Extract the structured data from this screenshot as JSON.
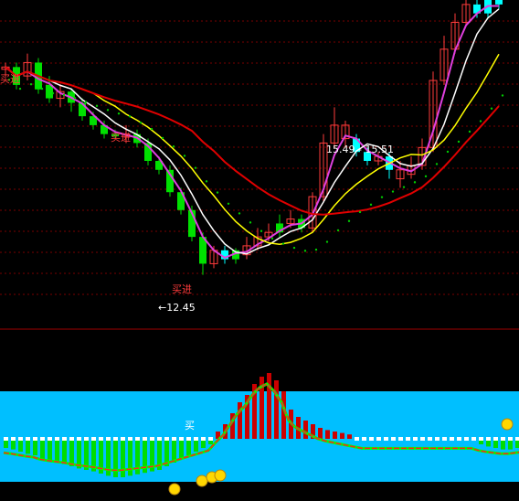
{
  "colors": {
    "background": "#000000",
    "up": "#ff3b3b",
    "down": "#00e000",
    "doji": "#00ffff",
    "ma_white": "#ffffff",
    "ma_yellow": "#ffff00",
    "ma_magenta": "#e040e0",
    "ma_red": "#e00000",
    "dots_green": "#00cc00",
    "panel_bg": "#00bfff",
    "hist_red": "#cc0000"
  },
  "annotations": {
    "buy_label": "买进",
    "low_label": "←12.45",
    "range_label": "15.49 - 15.51",
    "top_left_buy": "买进",
    "lower_buy": "买"
  },
  "chart_data": [
    {
      "type": "candlestick",
      "title": "",
      "grid": true,
      "ylim": [
        11.4,
        18.6
      ],
      "low_marker": 12.45,
      "range_marker": [
        15.49,
        15.51
      ],
      "candles": [
        {
          "o": 17.05,
          "c": 17.1,
          "h": 17.2,
          "l": 16.9,
          "dir": "up"
        },
        {
          "o": 17.1,
          "c": 16.7,
          "h": 17.2,
          "l": 16.6,
          "dir": "down"
        },
        {
          "o": 16.9,
          "c": 17.2,
          "h": 17.4,
          "l": 16.8,
          "dir": "up"
        },
        {
          "o": 17.2,
          "c": 16.6,
          "h": 17.3,
          "l": 16.5,
          "dir": "down"
        },
        {
          "o": 16.7,
          "c": 16.4,
          "h": 16.9,
          "l": 16.3,
          "dir": "down"
        },
        {
          "o": 16.4,
          "c": 16.55,
          "h": 16.7,
          "l": 16.2,
          "dir": "up"
        },
        {
          "o": 16.55,
          "c": 16.3,
          "h": 16.6,
          "l": 16.1,
          "dir": "down"
        },
        {
          "o": 16.3,
          "c": 16.0,
          "h": 16.4,
          "l": 15.9,
          "dir": "down"
        },
        {
          "o": 16.0,
          "c": 15.8,
          "h": 16.1,
          "l": 15.7,
          "dir": "down"
        },
        {
          "o": 15.8,
          "c": 15.6,
          "h": 15.9,
          "l": 15.5,
          "dir": "down"
        },
        {
          "o": 15.6,
          "c": 15.55,
          "h": 15.7,
          "l": 15.5,
          "dir": "down"
        },
        {
          "o": 15.55,
          "c": 15.6,
          "h": 15.8,
          "l": 15.4,
          "dir": "up"
        },
        {
          "o": 15.6,
          "c": 15.4,
          "h": 15.7,
          "l": 15.3,
          "dir": "down"
        },
        {
          "o": 15.4,
          "c": 15.0,
          "h": 15.5,
          "l": 14.9,
          "dir": "down"
        },
        {
          "o": 15.0,
          "c": 14.8,
          "h": 15.1,
          "l": 14.7,
          "dir": "down"
        },
        {
          "o": 14.8,
          "c": 14.3,
          "h": 14.9,
          "l": 14.2,
          "dir": "down"
        },
        {
          "o": 14.3,
          "c": 13.9,
          "h": 14.4,
          "l": 13.8,
          "dir": "down"
        },
        {
          "o": 13.9,
          "c": 13.3,
          "h": 14.0,
          "l": 13.2,
          "dir": "down"
        },
        {
          "o": 13.3,
          "c": 12.7,
          "h": 13.4,
          "l": 12.45,
          "dir": "down"
        },
        {
          "o": 12.7,
          "c": 13.0,
          "h": 13.1,
          "l": 12.6,
          "dir": "up"
        },
        {
          "o": 13.0,
          "c": 12.8,
          "h": 13.1,
          "l": 12.7,
          "dir": "doji"
        },
        {
          "o": 12.8,
          "c": 13.0,
          "h": 13.05,
          "l": 12.7,
          "dir": "down"
        },
        {
          "o": 12.9,
          "c": 13.1,
          "h": 13.3,
          "l": 12.8,
          "dir": "up"
        },
        {
          "o": 13.1,
          "c": 13.3,
          "h": 13.5,
          "l": 13.0,
          "dir": "up"
        },
        {
          "o": 13.3,
          "c": 13.4,
          "h": 13.6,
          "l": 13.2,
          "dir": "up"
        },
        {
          "o": 13.4,
          "c": 13.6,
          "h": 13.8,
          "l": 13.3,
          "dir": "down"
        },
        {
          "o": 13.6,
          "c": 13.7,
          "h": 13.9,
          "l": 13.5,
          "dir": "up"
        },
        {
          "o": 13.7,
          "c": 13.5,
          "h": 13.8,
          "l": 13.4,
          "dir": "down"
        },
        {
          "o": 13.5,
          "c": 14.2,
          "h": 14.3,
          "l": 13.4,
          "dir": "up"
        },
        {
          "o": 14.2,
          "c": 15.4,
          "h": 15.6,
          "l": 14.1,
          "dir": "up"
        },
        {
          "o": 15.4,
          "c": 15.8,
          "h": 16.2,
          "l": 15.3,
          "dir": "up"
        },
        {
          "o": 15.8,
          "c": 15.5,
          "h": 15.9,
          "l": 15.3,
          "dir": "up"
        },
        {
          "o": 15.5,
          "c": 15.2,
          "h": 15.6,
          "l": 15.1,
          "dir": "doji"
        },
        {
          "o": 15.2,
          "c": 15.0,
          "h": 15.3,
          "l": 14.9,
          "dir": "doji"
        },
        {
          "o": 15.0,
          "c": 15.1,
          "h": 15.2,
          "l": 14.9,
          "dir": "up"
        },
        {
          "o": 15.1,
          "c": 14.8,
          "h": 15.2,
          "l": 14.6,
          "dir": "doji"
        },
        {
          "o": 14.8,
          "c": 14.6,
          "h": 15.0,
          "l": 14.4,
          "dir": "up"
        },
        {
          "o": 14.7,
          "c": 14.9,
          "h": 15.1,
          "l": 14.6,
          "dir": "up"
        },
        {
          "o": 14.9,
          "c": 15.3,
          "h": 15.5,
          "l": 14.8,
          "dir": "up"
        },
        {
          "o": 15.3,
          "c": 16.8,
          "h": 17.0,
          "l": 15.2,
          "dir": "up"
        },
        {
          "o": 16.8,
          "c": 17.5,
          "h": 17.8,
          "l": 16.7,
          "dir": "up"
        },
        {
          "o": 17.5,
          "c": 18.1,
          "h": 18.3,
          "l": 17.4,
          "dir": "up"
        },
        {
          "o": 18.1,
          "c": 18.5,
          "h": 18.7,
          "l": 18.0,
          "dir": "up"
        },
        {
          "o": 18.5,
          "c": 18.3,
          "h": 18.8,
          "l": 18.2,
          "dir": "doji"
        },
        {
          "o": 18.3,
          "c": 18.6,
          "h": 18.9,
          "l": 18.2,
          "dir": "doji"
        },
        {
          "o": 18.6,
          "c": 18.5,
          "h": 18.9,
          "l": 18.4,
          "dir": "doji"
        }
      ]
    },
    {
      "type": "bar",
      "title": "",
      "grid": false,
      "ylim": [
        -6,
        10
      ],
      "series": [
        {
          "values": [
            0.2,
            0.2,
            0.2,
            0.2,
            0.2,
            0.2,
            0.2,
            0.2,
            0.2,
            0.2,
            0.2,
            0.2,
            0.2,
            0.2,
            0.2,
            0.2,
            0.2,
            0.2,
            0.2,
            0.2,
            0.2,
            0.2,
            0.2,
            0.2,
            0.2,
            0.2,
            0.2,
            0.2,
            0.2,
            1.0,
            2.0,
            3.5,
            5.0,
            6.0,
            7.5,
            8.5,
            9.0,
            8.0,
            6.5,
            4.0,
            3.0,
            2.5,
            2.0,
            1.5,
            1.2,
            1.0,
            0.8,
            0.6,
            0.4,
            0.2,
            0.2,
            0.2,
            0.2,
            0.2,
            0.2,
            0.2,
            0.2,
            0.2,
            0.2,
            0.2,
            0.2,
            0.2,
            0.2,
            0.2,
            0.2,
            0.2,
            0.2,
            0.2,
            0.2,
            0.2,
            0.2,
            0.2
          ]
        },
        {
          "values": [
            -1.0,
            -1.2,
            -1.5,
            -1.8,
            -2.0,
            -2.5,
            -2.8,
            -3.0,
            -3.2,
            -3.5,
            -3.8,
            -4.0,
            -4.2,
            -4.5,
            -4.8,
            -5.0,
            -5.0,
            -4.8,
            -4.6,
            -4.4,
            -4.2,
            -4.0,
            -3.5,
            -3.0,
            -2.5,
            -2.0,
            -1.5,
            -1.0,
            -0.5,
            0,
            0,
            0,
            0,
            0,
            0,
            0,
            0,
            0,
            0,
            0,
            0,
            0,
            0,
            0,
            0,
            0,
            0,
            0,
            0,
            0,
            0,
            0,
            0,
            0,
            0,
            0,
            0,
            0,
            0,
            0,
            0,
            0,
            0,
            0,
            0,
            -0.5,
            -0.8,
            -1.0,
            -1.2,
            -1.2,
            -1.0,
            -0.8
          ]
        }
      ]
    }
  ]
}
